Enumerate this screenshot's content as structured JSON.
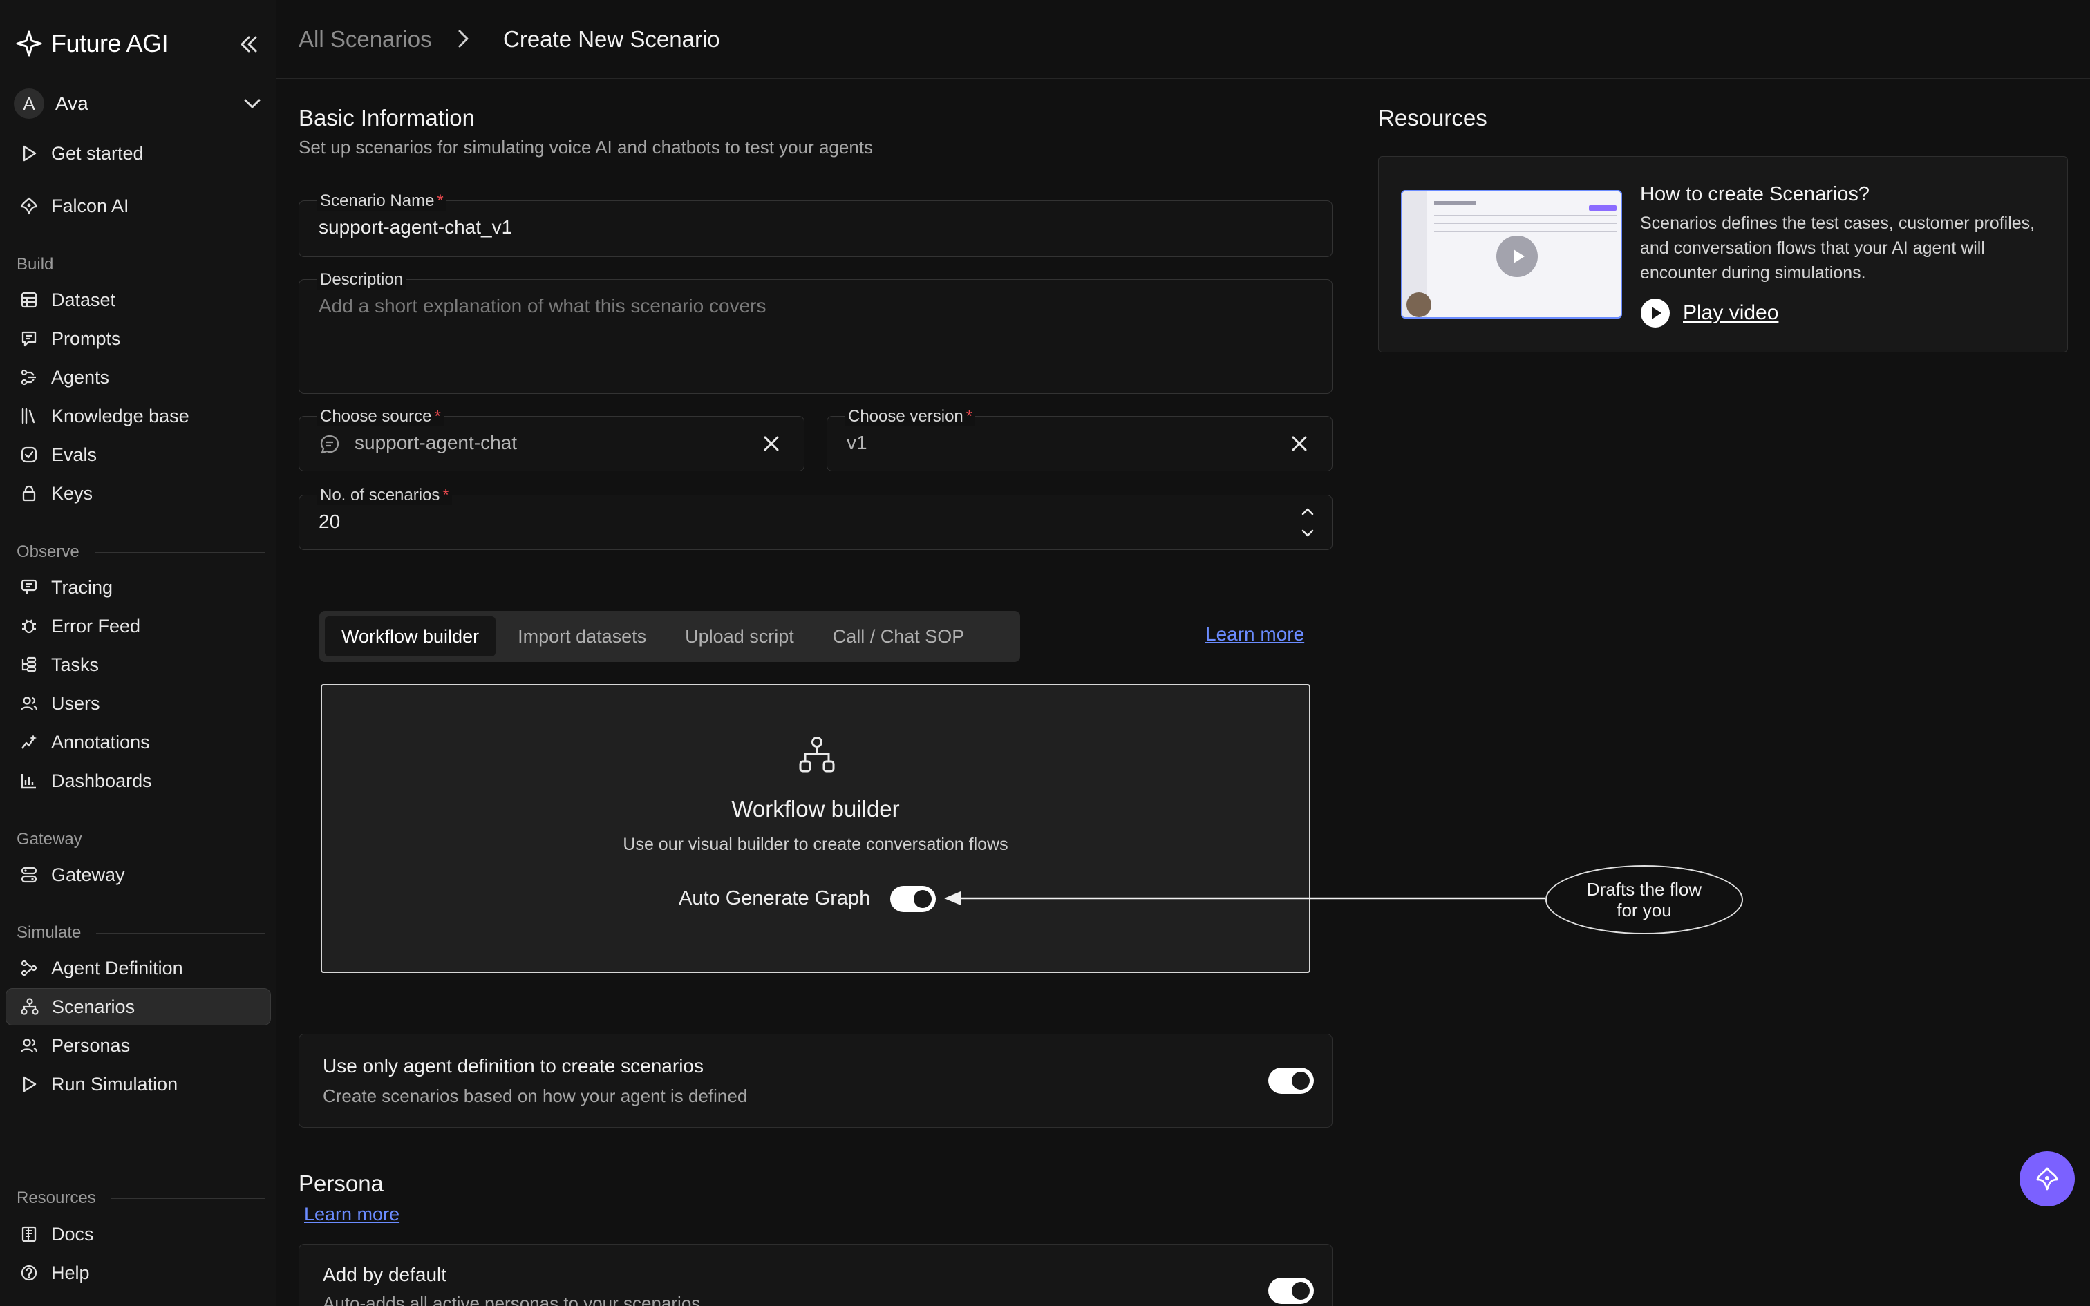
{
  "app": {
    "brand": "Future AGI"
  },
  "user": {
    "initial": "A",
    "name": "Ava"
  },
  "sidebar": {
    "top_items": [
      {
        "label": "Get started",
        "icon": "play-icon"
      },
      {
        "label": "Falcon AI",
        "icon": "falcon-icon"
      }
    ],
    "sections": {
      "build": "Build",
      "observe": "Observe",
      "gateway": "Gateway",
      "simulate": "Simulate",
      "resources": "Resources"
    },
    "build_items": [
      {
        "label": "Dataset",
        "icon": "table-icon"
      },
      {
        "label": "Prompts",
        "icon": "prompt-icon"
      },
      {
        "label": "Agents",
        "icon": "agents-icon"
      },
      {
        "label": "Knowledge base",
        "icon": "library-icon"
      },
      {
        "label": "Evals",
        "icon": "check-circle-icon"
      },
      {
        "label": "Keys",
        "icon": "lock-icon"
      }
    ],
    "observe_items": [
      {
        "label": "Tracing",
        "icon": "tracing-icon"
      },
      {
        "label": "Error Feed",
        "icon": "bug-icon"
      },
      {
        "label": "Tasks",
        "icon": "tasks-icon"
      },
      {
        "label": "Users",
        "icon": "users-icon"
      },
      {
        "label": "Annotations",
        "icon": "annotation-icon"
      },
      {
        "label": "Dashboards",
        "icon": "bar-chart-icon"
      }
    ],
    "gateway_items": [
      {
        "label": "Gateway",
        "icon": "gateway-icon"
      }
    ],
    "simulate_items": [
      {
        "label": "Agent Definition",
        "icon": "agent-definition-icon"
      },
      {
        "label": "Scenarios",
        "icon": "scenarios-icon",
        "active": true
      },
      {
        "label": "Personas",
        "icon": "personas-icon"
      },
      {
        "label": "Run Simulation",
        "icon": "play-icon"
      }
    ],
    "resource_items": [
      {
        "label": "Docs",
        "icon": "docs-icon"
      },
      {
        "label": "Help",
        "icon": "help-icon"
      }
    ]
  },
  "breadcrumb": {
    "parent": "All Scenarios",
    "current": "Create New Scenario"
  },
  "basic": {
    "title": "Basic Information",
    "subtitle": "Set up scenarios for simulating voice AI and chatbots to test your agents"
  },
  "form": {
    "name_label": "Scenario Name",
    "name_value": "support-agent-chat_v1",
    "desc_label": "Description",
    "desc_placeholder": "Add a short explanation of what this scenario covers",
    "source_label": "Choose source",
    "source_value": "support-agent-chat",
    "version_label": "Choose version",
    "version_value": "v1",
    "count_label": "No. of scenarios",
    "count_value": "20",
    "required_mark": "*"
  },
  "tabs": {
    "items": [
      "Workflow builder",
      "Import datasets",
      "Upload script",
      "Call / Chat SOP"
    ],
    "active_index": 0,
    "learn_more": "Learn more"
  },
  "workflow": {
    "title": "Workflow builder",
    "subtitle": "Use our visual builder to create conversation flows",
    "auto_label": "Auto Generate Graph",
    "auto_on": true
  },
  "agent_only": {
    "title": "Use only agent definition to create scenarios",
    "subtitle": "Create scenarios based on how your agent is defined",
    "on": true
  },
  "persona": {
    "title": "Persona",
    "learn_more": "Learn more",
    "add_title": "Add by default",
    "add_subtitle": "Auto-adds all active personas to your scenarios",
    "on": true
  },
  "resources": {
    "title": "Resources",
    "card_title": "How to create Scenarios?",
    "card_desc": "Scenarios defines the test cases, customer profiles, and conversation flows that your AI agent will encounter during simulations.",
    "play_label": "Play video"
  },
  "annotation": {
    "line1": "Drafts the flow",
    "line2": "for you"
  },
  "colors": {
    "accent": "#7b61ff",
    "link": "#6b8cff",
    "required": "#e5484d",
    "background": "#111111"
  }
}
